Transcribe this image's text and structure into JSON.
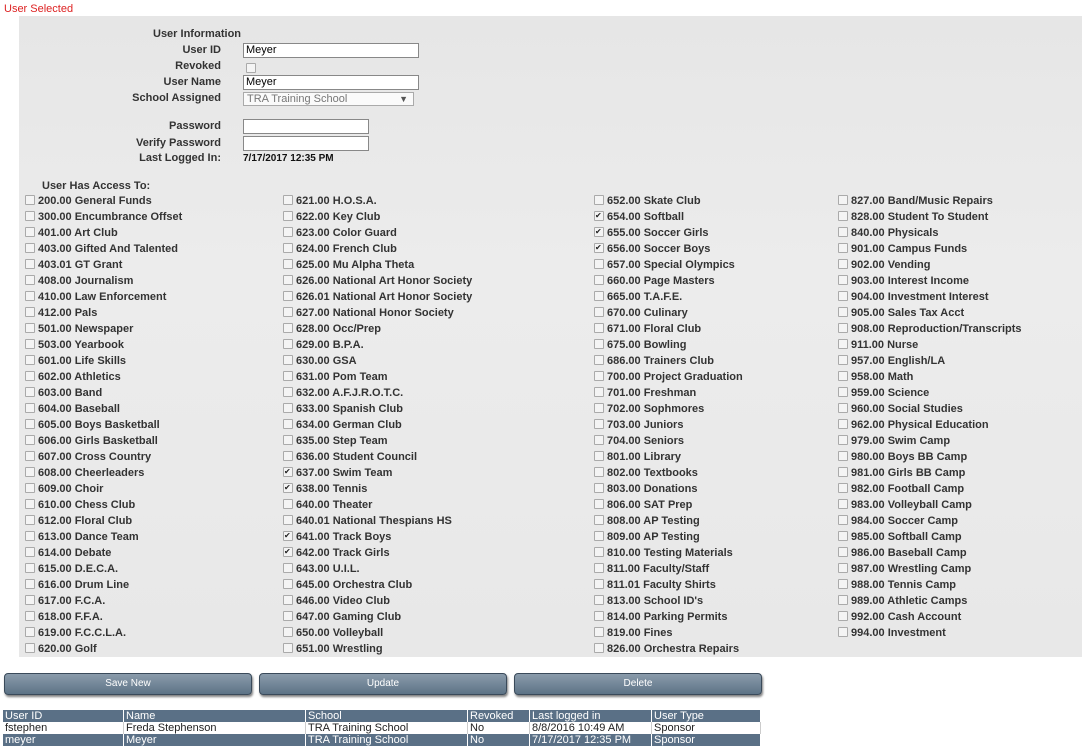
{
  "status": "User Selected",
  "form": {
    "section_title": "User Information",
    "user_id_label": "User ID",
    "user_id_value": "Meyer",
    "revoked_label": "Revoked",
    "user_name_label": "User Name",
    "user_name_value": "Meyer",
    "school_label": "School Assigned",
    "school_value": "TRA Training School",
    "password_label": "Password",
    "verify_label": "Verify Password",
    "last_logged_label": "Last Logged In:",
    "last_logged_value": "7/17/2017 12:35 PM",
    "access_title": "User Has Access To:"
  },
  "access": {
    "columns": [
      [
        {
          "label": "200.00 General Funds",
          "checked": false
        },
        {
          "label": "300.00 Encumbrance Offset",
          "checked": false
        },
        {
          "label": "401.00 Art Club",
          "checked": false
        },
        {
          "label": "403.00 Gifted And Talented",
          "checked": false
        },
        {
          "label": "403.01 GT Grant",
          "checked": false
        },
        {
          "label": "408.00 Journalism",
          "checked": false
        },
        {
          "label": "410.00 Law Enforcement",
          "checked": false
        },
        {
          "label": "412.00 Pals",
          "checked": false
        },
        {
          "label": "501.00 Newspaper",
          "checked": false
        },
        {
          "label": "503.00 Yearbook",
          "checked": false
        },
        {
          "label": "601.00 Life Skills",
          "checked": false
        },
        {
          "label": "602.00 Athletics",
          "checked": false
        },
        {
          "label": "603.00 Band",
          "checked": false
        },
        {
          "label": "604.00 Baseball",
          "checked": false
        },
        {
          "label": "605.00 Boys Basketball",
          "checked": false
        },
        {
          "label": "606.00 Girls Basketball",
          "checked": false
        },
        {
          "label": "607.00 Cross Country",
          "checked": false
        },
        {
          "label": "608.00 Cheerleaders",
          "checked": false
        },
        {
          "label": "609.00 Choir",
          "checked": false
        },
        {
          "label": "610.00 Chess Club",
          "checked": false
        },
        {
          "label": "612.00 Floral Club",
          "checked": false
        },
        {
          "label": "613.00 Dance Team",
          "checked": false
        },
        {
          "label": "614.00 Debate",
          "checked": false
        },
        {
          "label": "615.00 D.E.C.A.",
          "checked": false
        },
        {
          "label": "616.00 Drum Line",
          "checked": false
        },
        {
          "label": "617.00 F.C.A.",
          "checked": false
        },
        {
          "label": "618.00 F.F.A.",
          "checked": false
        },
        {
          "label": "619.00 F.C.C.L.A.",
          "checked": false
        },
        {
          "label": "620.00 Golf",
          "checked": false
        }
      ],
      [
        {
          "label": "621.00 H.O.S.A.",
          "checked": false
        },
        {
          "label": "622.00 Key Club",
          "checked": false
        },
        {
          "label": "623.00 Color Guard",
          "checked": false
        },
        {
          "label": "624.00 French Club",
          "checked": false
        },
        {
          "label": "625.00 Mu Alpha Theta",
          "checked": false
        },
        {
          "label": "626.00 National Art Honor Society",
          "checked": false
        },
        {
          "label": "626.01 National Art Honor Society",
          "checked": false
        },
        {
          "label": "627.00 National Honor Society",
          "checked": false
        },
        {
          "label": "628.00 Occ/Prep",
          "checked": false
        },
        {
          "label": "629.00 B.P.A.",
          "checked": false
        },
        {
          "label": "630.00 GSA",
          "checked": false
        },
        {
          "label": "631.00 Pom Team",
          "checked": false
        },
        {
          "label": "632.00 A.F.J.R.O.T.C.",
          "checked": false
        },
        {
          "label": "633.00 Spanish Club",
          "checked": false
        },
        {
          "label": "634.00 German Club",
          "checked": false
        },
        {
          "label": "635.00 Step Team",
          "checked": false
        },
        {
          "label": "636.00 Student Council",
          "checked": false
        },
        {
          "label": "637.00 Swim Team",
          "checked": true
        },
        {
          "label": "638.00 Tennis",
          "checked": true
        },
        {
          "label": "640.00 Theater",
          "checked": false
        },
        {
          "label": "640.01 National Thespians HS",
          "checked": false
        },
        {
          "label": "641.00 Track Boys",
          "checked": true
        },
        {
          "label": "642.00 Track Girls",
          "checked": true
        },
        {
          "label": "643.00 U.I.L.",
          "checked": false
        },
        {
          "label": "645.00 Orchestra Club",
          "checked": false
        },
        {
          "label": "646.00 Video Club",
          "checked": false
        },
        {
          "label": "647.00 Gaming Club",
          "checked": false
        },
        {
          "label": "650.00 Volleyball",
          "checked": false
        },
        {
          "label": "651.00 Wrestling",
          "checked": false
        }
      ],
      [
        {
          "label": "652.00 Skate Club",
          "checked": false
        },
        {
          "label": "654.00 Softball",
          "checked": true
        },
        {
          "label": "655.00 Soccer Girls",
          "checked": true
        },
        {
          "label": "656.00 Soccer Boys",
          "checked": true
        },
        {
          "label": "657.00 Special Olympics",
          "checked": false
        },
        {
          "label": "660.00 Page Masters",
          "checked": false
        },
        {
          "label": "665.00 T.A.F.E.",
          "checked": false
        },
        {
          "label": "670.00 Culinary",
          "checked": false
        },
        {
          "label": "671.00 Floral Club",
          "checked": false
        },
        {
          "label": "675.00 Bowling",
          "checked": false
        },
        {
          "label": "686.00 Trainers Club",
          "checked": false
        },
        {
          "label": "700.00 Project Graduation",
          "checked": false
        },
        {
          "label": "701.00 Freshman",
          "checked": false
        },
        {
          "label": "702.00 Sophmores",
          "checked": false
        },
        {
          "label": "703.00 Juniors",
          "checked": false
        },
        {
          "label": "704.00 Seniors",
          "checked": false
        },
        {
          "label": "801.00 Library",
          "checked": false
        },
        {
          "label": "802.00 Textbooks",
          "checked": false
        },
        {
          "label": "803.00 Donations",
          "checked": false
        },
        {
          "label": "806.00 SAT Prep",
          "checked": false
        },
        {
          "label": "808.00 AP Testing",
          "checked": false
        },
        {
          "label": "809.00 AP Testing",
          "checked": false
        },
        {
          "label": "810.00 Testing Materials",
          "checked": false
        },
        {
          "label": "811.00 Faculty/Staff",
          "checked": false
        },
        {
          "label": "811.01 Faculty Shirts",
          "checked": false
        },
        {
          "label": "813.00 School ID's",
          "checked": false
        },
        {
          "label": "814.00 Parking Permits",
          "checked": false
        },
        {
          "label": "819.00 Fines",
          "checked": false
        },
        {
          "label": "826.00 Orchestra Repairs",
          "checked": false
        }
      ],
      [
        {
          "label": "827.00 Band/Music Repairs",
          "checked": false
        },
        {
          "label": "828.00 Student To Student",
          "checked": false
        },
        {
          "label": "840.00 Physicals",
          "checked": false
        },
        {
          "label": "901.00 Campus Funds",
          "checked": false
        },
        {
          "label": "902.00 Vending",
          "checked": false
        },
        {
          "label": "903.00 Interest Income",
          "checked": false
        },
        {
          "label": "904.00 Investment Interest",
          "checked": false
        },
        {
          "label": "905.00 Sales Tax Acct",
          "checked": false
        },
        {
          "label": "908.00 Reproduction/Transcripts",
          "checked": false
        },
        {
          "label": "911.00 Nurse",
          "checked": false
        },
        {
          "label": "957.00 English/LA",
          "checked": false
        },
        {
          "label": "958.00 Math",
          "checked": false
        },
        {
          "label": "959.00 Science",
          "checked": false
        },
        {
          "label": "960.00 Social Studies",
          "checked": false
        },
        {
          "label": "962.00 Physical Education",
          "checked": false
        },
        {
          "label": "979.00 Swim Camp",
          "checked": false
        },
        {
          "label": "980.00 Boys BB Camp",
          "checked": false
        },
        {
          "label": "981.00 Girls BB Camp",
          "checked": false
        },
        {
          "label": "982.00 Football Camp",
          "checked": false
        },
        {
          "label": "983.00 Volleyball Camp",
          "checked": false
        },
        {
          "label": "984.00 Soccer Camp",
          "checked": false
        },
        {
          "label": "985.00 Softball Camp",
          "checked": false
        },
        {
          "label": "986.00 Baseball Camp",
          "checked": false
        },
        {
          "label": "987.00 Wrestling Camp",
          "checked": false
        },
        {
          "label": "988.00 Tennis Camp",
          "checked": false
        },
        {
          "label": "989.00 Athletic Camps",
          "checked": false
        },
        {
          "label": "992.00 Cash Account",
          "checked": false
        },
        {
          "label": "994.00 Investment",
          "checked": false
        }
      ]
    ]
  },
  "buttons": {
    "save_new": "Save New",
    "update": "Update",
    "delete": "Delete"
  },
  "table": {
    "headers": [
      "User ID",
      "Name",
      "School",
      "Revoked",
      "Last logged in",
      "User Type"
    ],
    "rows": [
      {
        "cells": [
          "fstephen",
          "Freda Stephenson",
          "TRA Training School",
          "No",
          "8/8/2016 10:49 AM",
          "Sponsor"
        ],
        "selected": false
      },
      {
        "cells": [
          "meyer",
          "Meyer",
          "TRA Training School",
          "No",
          "7/17/2017 12:35 PM",
          "Sponsor"
        ],
        "selected": true
      }
    ]
  }
}
